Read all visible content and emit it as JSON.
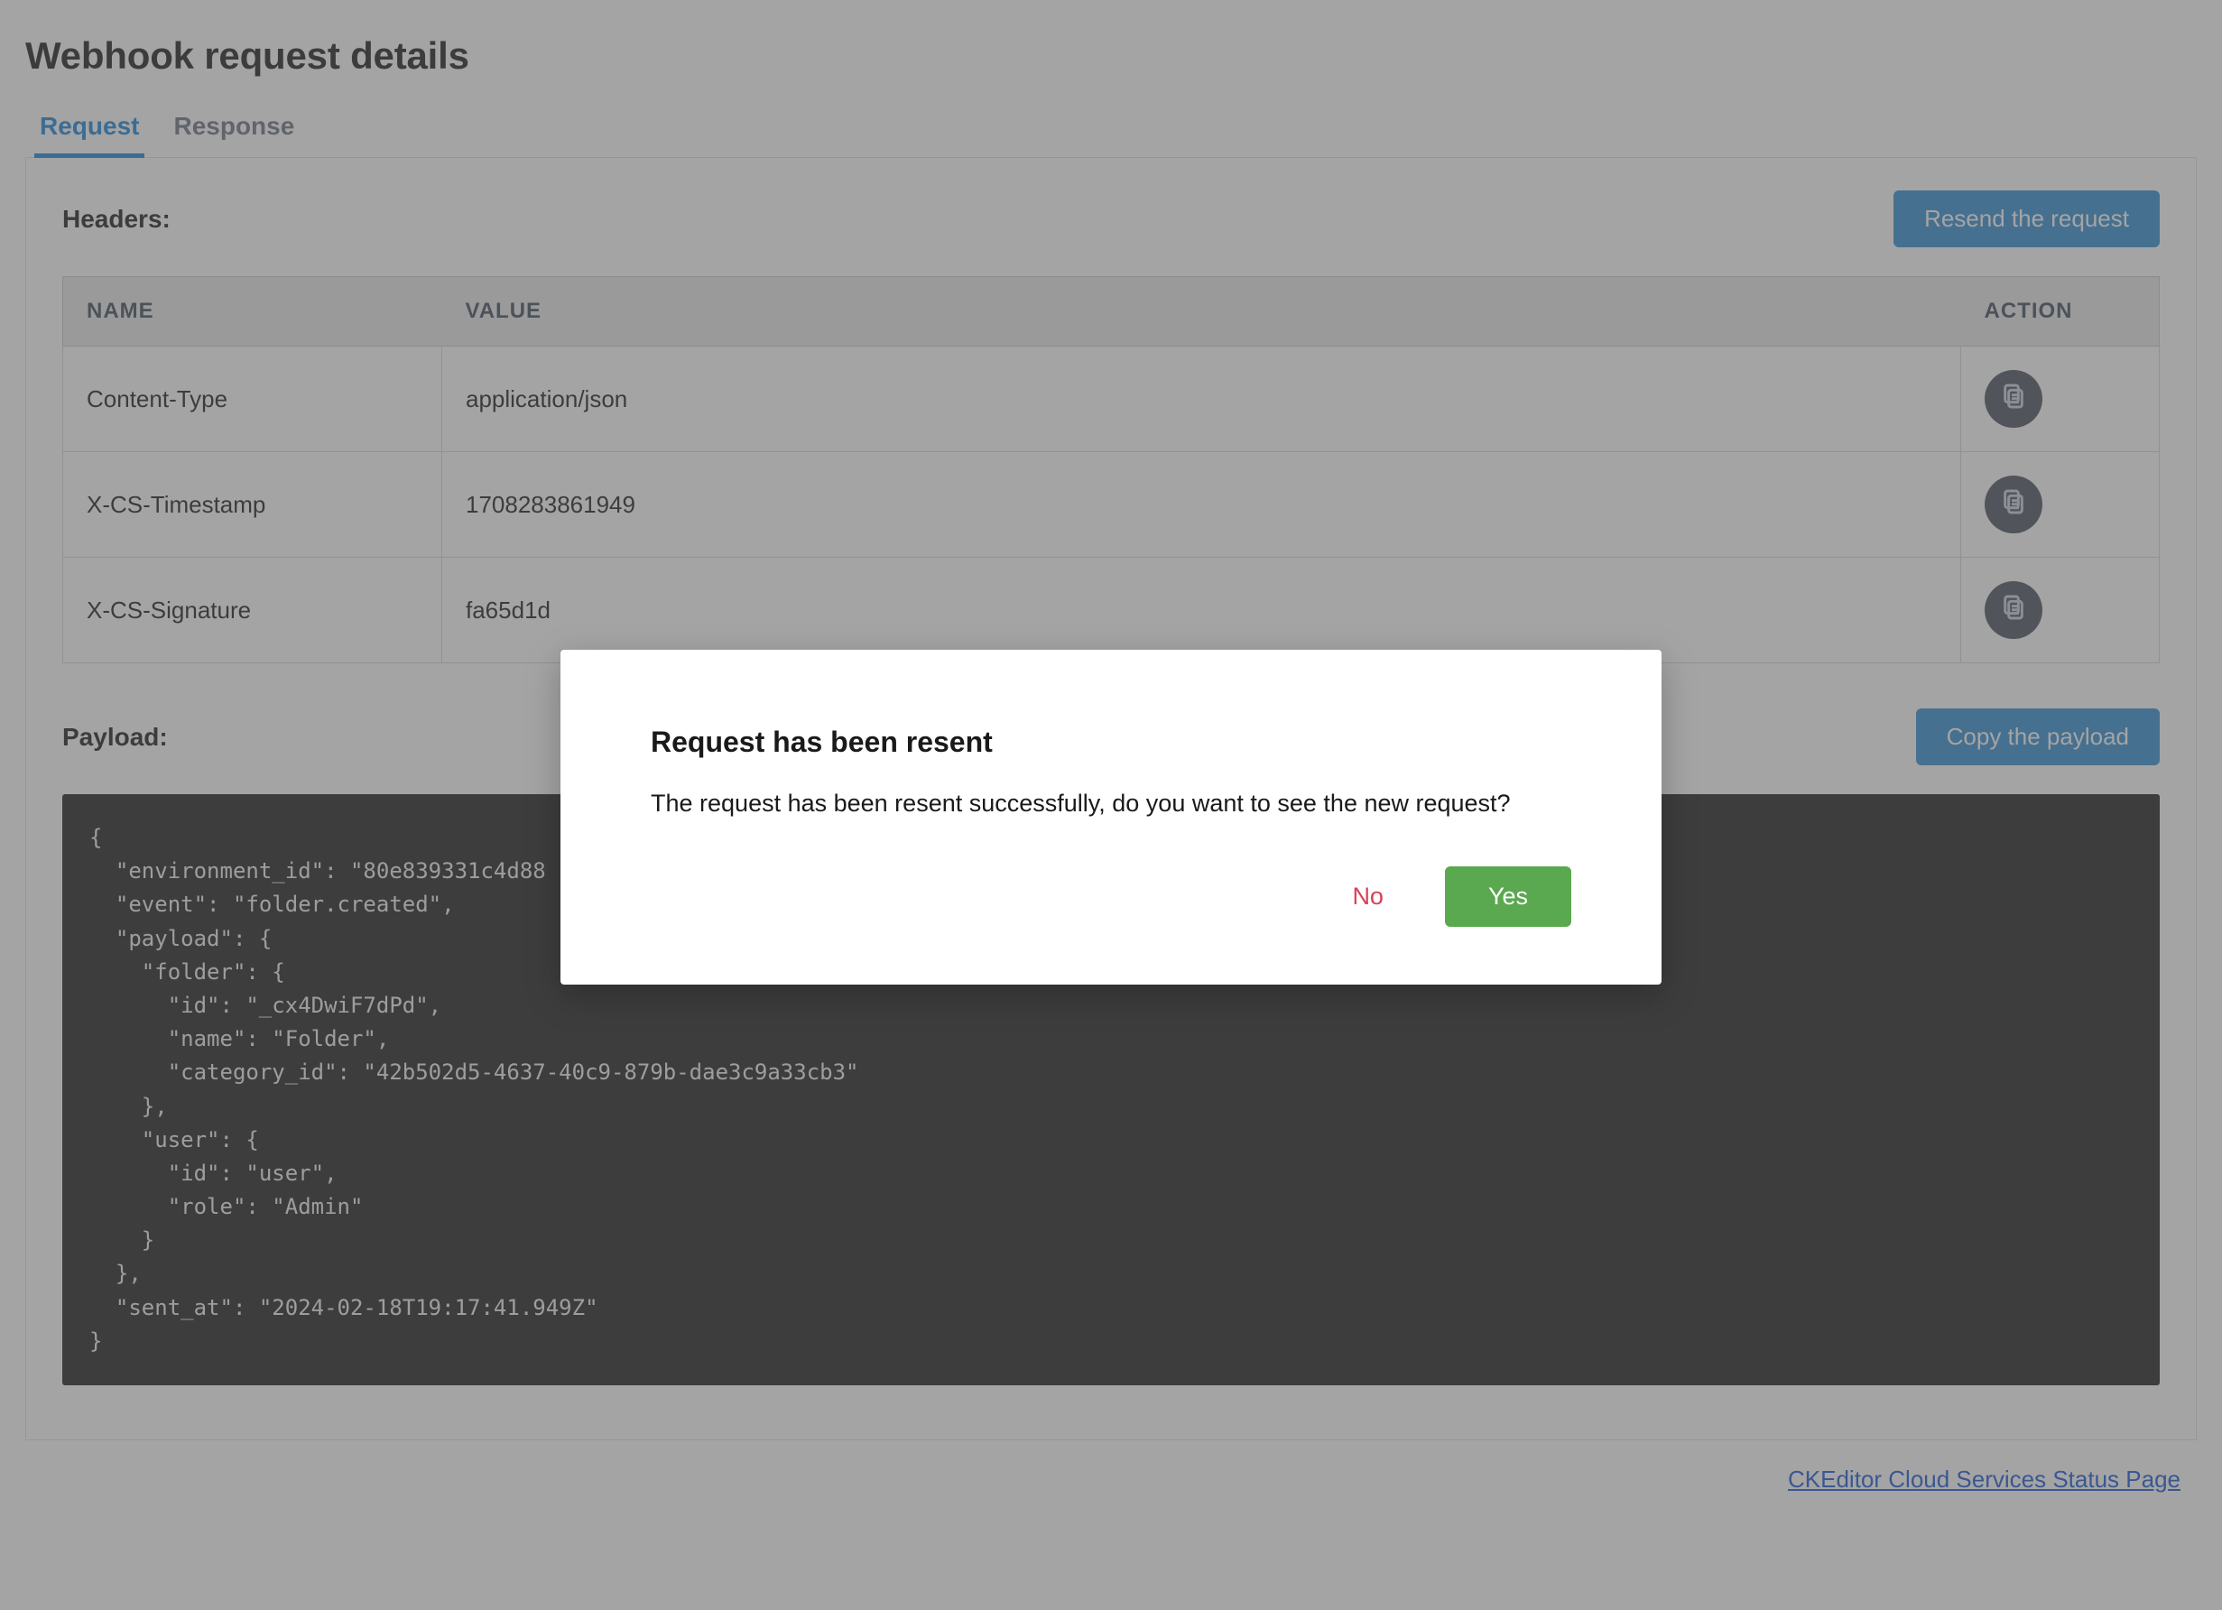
{
  "title": "Webhook request details",
  "tabs": {
    "request": "Request",
    "response": "Response"
  },
  "headers_section": {
    "label": "Headers:",
    "resend_btn": "Resend the request",
    "cols": {
      "name": "NAME",
      "value": "VALUE",
      "action": "ACTION"
    },
    "rows": [
      {
        "name": "Content-Type",
        "value": "application/json"
      },
      {
        "name": "X-CS-Timestamp",
        "value": "1708283861949"
      },
      {
        "name": "X-CS-Signature",
        "value": "fa65d1d"
      }
    ]
  },
  "payload_section": {
    "label": "Payload:",
    "copy_btn": "Copy the payload",
    "code": "{\n  \"environment_id\": \"80e839331c4d88\n  \"event\": \"folder.created\",\n  \"payload\": {\n    \"folder\": {\n      \"id\": \"_cx4DwiF7dPd\",\n      \"name\": \"Folder\",\n      \"category_id\": \"42b502d5-4637-40c9-879b-dae3c9a33cb3\"\n    },\n    \"user\": {\n      \"id\": \"user\",\n      \"role\": \"Admin\"\n    }\n  },\n  \"sent_at\": \"2024-02-18T19:17:41.949Z\"\n}"
  },
  "footer": {
    "status_link": "CKEditor Cloud Services Status Page"
  },
  "modal": {
    "title": "Request has been resent",
    "message": "The request has been resent successfully, do you want to see the new request?",
    "no": "No",
    "yes": "Yes"
  }
}
